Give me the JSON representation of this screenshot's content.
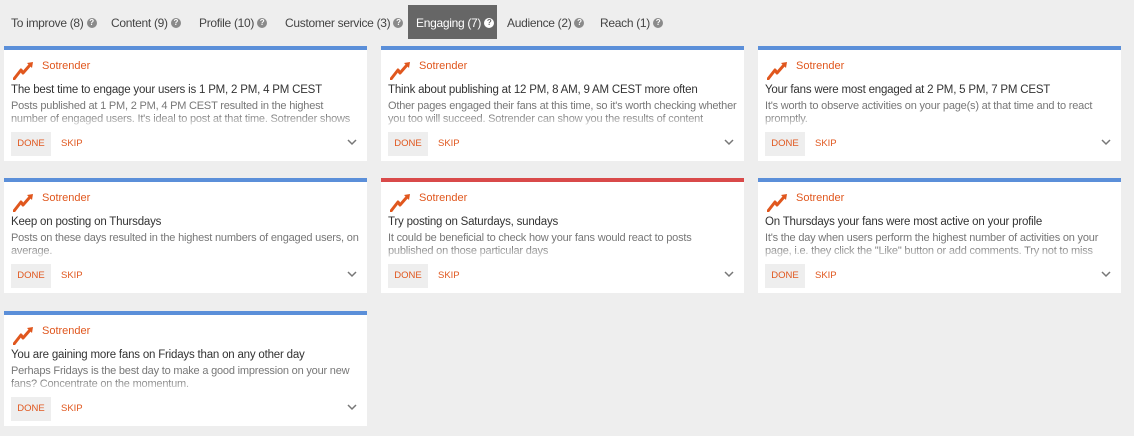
{
  "tabs": [
    {
      "label": "To improve (8)"
    },
    {
      "label": "Content (9)"
    },
    {
      "label": "Profile (10)"
    },
    {
      "label": "Customer service (3)"
    },
    {
      "label": "Engaging (7)"
    },
    {
      "label": "Audience (2)"
    },
    {
      "label": "Reach (1)"
    }
  ],
  "help_glyph": "?",
  "cards": [
    {
      "brand": "Sotrender",
      "title": "The best time to engage your users is 1 PM, 2 PM, 4 PM CEST",
      "desc": "Posts published at 1 PM, 2 PM, 4 PM CEST resulted in the highest number of engaged users. It's ideal to post at that time. Sotrender shows you exactly",
      "done": "DONE",
      "skip": "SKIP",
      "accent": "#5b8fd9"
    },
    {
      "brand": "Sotrender",
      "title": "Think about publishing at 12 PM, 8 AM, 9 AM CEST more often",
      "desc": "Other pages engaged their fans at this time, so it's worth checking whether you too will succeed. Sotrender can show you the results of content",
      "done": "DONE",
      "skip": "SKIP",
      "accent": "#5b8fd9"
    },
    {
      "brand": "Sotrender",
      "title": "Your fans were most engaged at 2 PM, 5 PM, 7 PM CEST",
      "desc": "It's worth to observe activities on your page(s) at that time and to react promptly.",
      "done": "DONE",
      "skip": "SKIP",
      "accent": "#5b8fd9"
    },
    {
      "brand": "Sotrender",
      "title": "Keep on posting on Thursdays",
      "desc": "Posts on these days resulted in the highest numbers of engaged users, on average.",
      "done": "DONE",
      "skip": "SKIP",
      "accent": "#5b8fd9"
    },
    {
      "brand": "Sotrender",
      "title": "Try posting on Saturdays, sundays",
      "desc": "It could be beneficial to check how your fans would react to posts published on those particular days",
      "done": "DONE",
      "skip": "SKIP",
      "accent": "#d94a4a"
    },
    {
      "brand": "Sotrender",
      "title": "On Thursdays your fans were most active on your profile",
      "desc": "It's the day when users perform the highest number of activities on your page, i.e. they click the \"Like\" button or add comments. Try not to miss",
      "done": "DONE",
      "skip": "SKIP",
      "accent": "#5b8fd9"
    },
    {
      "brand": "Sotrender",
      "title": "You are gaining more fans on Fridays than on any other day",
      "desc": "Perhaps Fridays is the best day to make a good impression on your new fans? Concentrate on the momentum.",
      "done": "DONE",
      "skip": "SKIP",
      "accent": "#5b8fd9"
    }
  ],
  "colors": {
    "brand": "#e0571e",
    "accent_blue": "#5b8fd9",
    "accent_red": "#d94a4a",
    "active_tab": "#666666"
  }
}
